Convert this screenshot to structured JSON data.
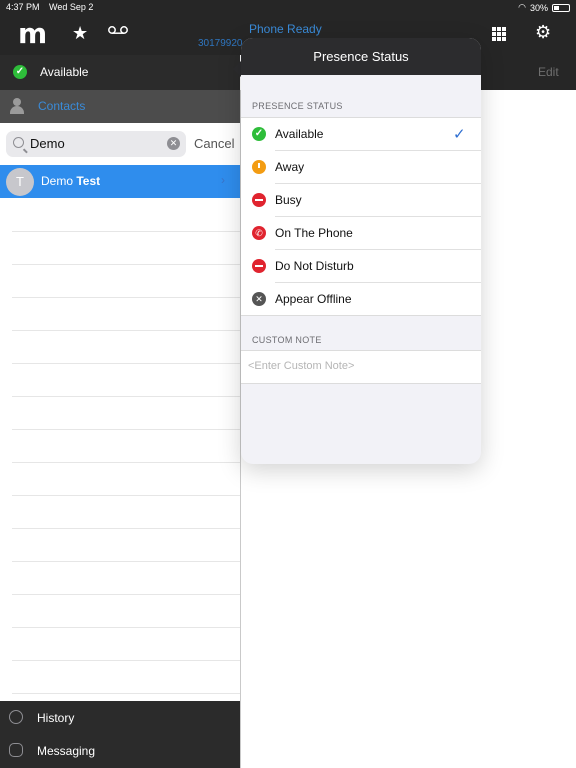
{
  "status_bar": {
    "time": "4:37 PM",
    "date": "Wed Sep 2",
    "battery": "30%"
  },
  "header": {
    "logo": "m",
    "phone_status": "Phone Ready",
    "phone_number": "30179920"
  },
  "left": {
    "availability": "Available",
    "contacts_tab": "Contacts",
    "search": {
      "value": "Demo",
      "cancel": "Cancel"
    },
    "contacts": [
      {
        "initial": "T",
        "first": "Demo",
        "last": "Test"
      }
    ],
    "bottom_nav": [
      "History",
      "Messaging"
    ]
  },
  "right": {
    "edit": "Edit"
  },
  "popover": {
    "title": "Presence Status",
    "section_presence": "PRESENCE STATUS",
    "options": [
      "Available",
      "Away",
      "Busy",
      "On The Phone",
      "Do Not Disturb",
      "Appear Offline"
    ],
    "selected": "Available",
    "section_note": "CUSTOM NOTE",
    "note_placeholder": "<Enter Custom Note>"
  }
}
